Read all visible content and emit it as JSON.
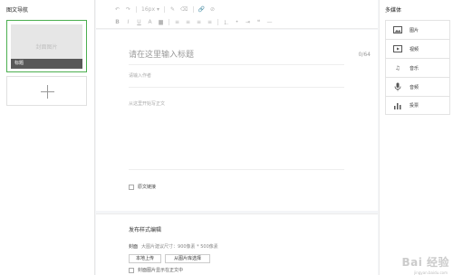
{
  "left_panel": {
    "title": "图文导航",
    "card": {
      "cover_text": "封面图片",
      "caption": "标题"
    }
  },
  "toolbar": {
    "font_size": "16px",
    "font_size_arrow": "▾"
  },
  "editor": {
    "title_placeholder": "请在这里输入标题",
    "title_counter": "0/64",
    "author_placeholder": "请输入作者",
    "body_placeholder": "从这里开始写正文",
    "original_link_label": "原文链接"
  },
  "publish": {
    "title": "发布样式编辑",
    "cover_label": "封面",
    "cover_hint": "大图片建议尺寸：900像素 * 500像素",
    "upload_button": "本地上传",
    "library_button": "从图片库选择",
    "show_in_body_label": "封面图片显示在正文中"
  },
  "media_panel": {
    "title": "多媒体",
    "items": [
      {
        "label": "图片",
        "icon": "image-icon"
      },
      {
        "label": "视频",
        "icon": "video-icon"
      },
      {
        "label": "音乐",
        "icon": "music-icon"
      },
      {
        "label": "音频",
        "icon": "microphone-icon"
      },
      {
        "label": "投票",
        "icon": "poll-icon"
      }
    ]
  },
  "watermark": {
    "brand": "Bai 经验",
    "site": "jingyan.baidu.com"
  },
  "colors": {
    "selection_green": "#4caf50",
    "cover_caption_bg": "#3a3a3a"
  }
}
